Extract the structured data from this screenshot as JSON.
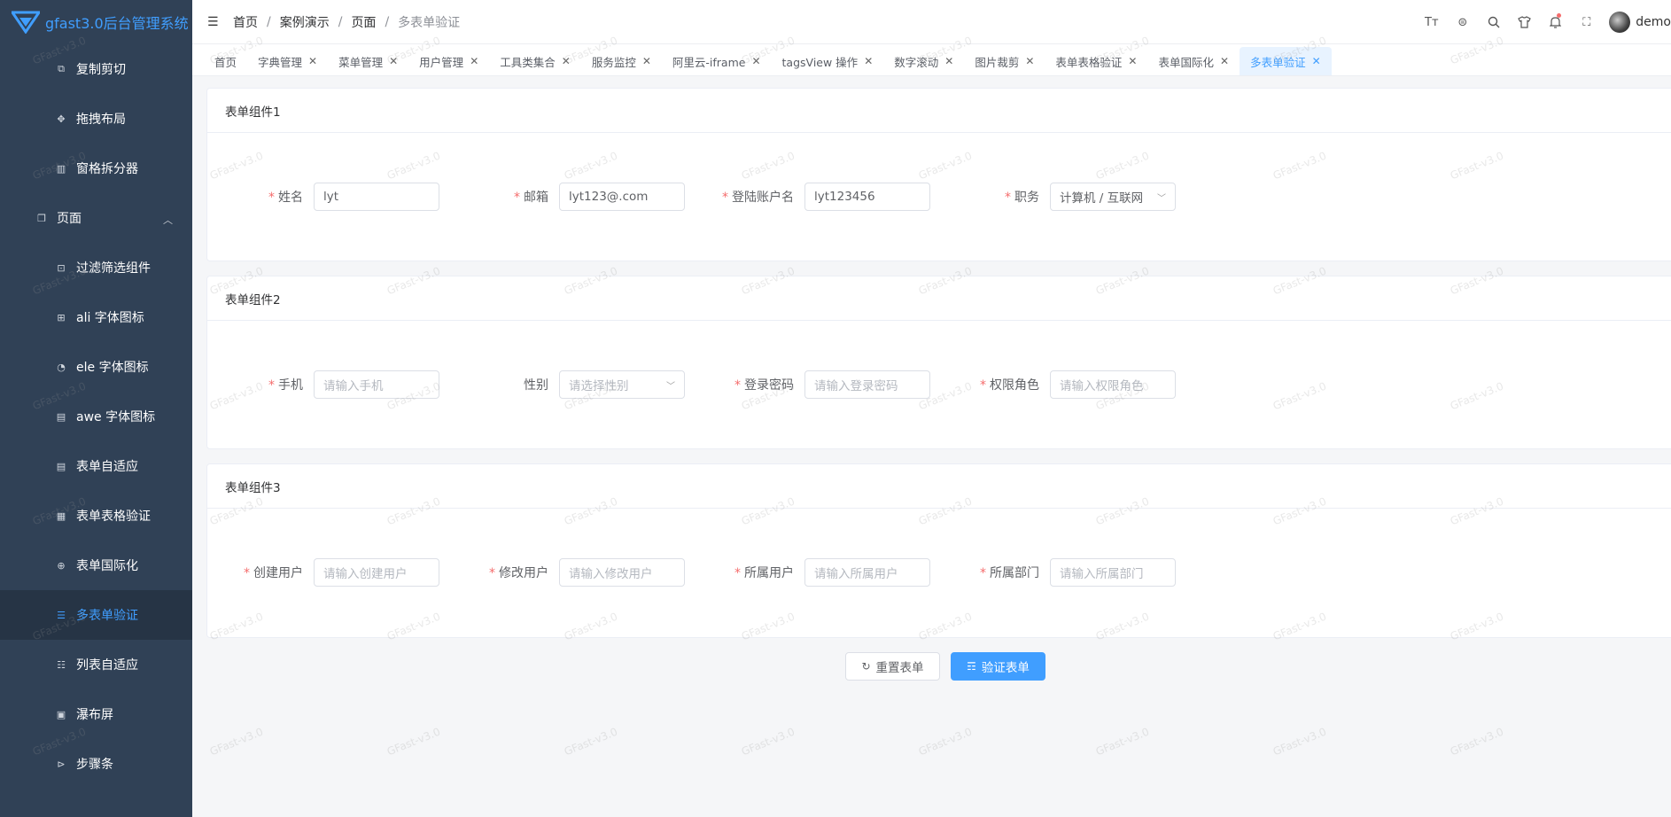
{
  "app": {
    "title": "gfast3.0后台管理系统",
    "watermark": "GFast-v3.0"
  },
  "sidebar": {
    "items": [
      {
        "label": "复制剪切",
        "icon": "copy-icon"
      },
      {
        "label": "拖拽布局",
        "icon": "drag-icon"
      },
      {
        "label": "窗格拆分器",
        "icon": "split-pane-icon"
      },
      {
        "label": "页面",
        "icon": "page-icon"
      },
      {
        "label": "过滤筛选组件",
        "icon": "filter-icon"
      },
      {
        "label": "ali 字体图标",
        "icon": "gift-icon"
      },
      {
        "label": "ele 字体图标",
        "icon": "ele-icon"
      },
      {
        "label": "awe 字体图标",
        "icon": "awe-icon"
      },
      {
        "label": "表单自适应",
        "icon": "form-icon"
      },
      {
        "label": "表单表格验证",
        "icon": "table-icon"
      },
      {
        "label": "表单国际化",
        "icon": "globe-icon"
      },
      {
        "label": "多表单验证",
        "icon": "forms-icon"
      },
      {
        "label": "列表自适应",
        "icon": "list-icon"
      },
      {
        "label": "瀑布屏",
        "icon": "waterfall-icon"
      },
      {
        "label": "步骤条",
        "icon": "steps-icon"
      }
    ]
  },
  "breadcrumb": [
    "首页",
    "案例演示",
    "页面",
    "多表单验证"
  ],
  "header": {
    "username": "demo"
  },
  "tabs": [
    {
      "label": "首页"
    },
    {
      "label": "字典管理"
    },
    {
      "label": "菜单管理"
    },
    {
      "label": "用户管理"
    },
    {
      "label": "工具类集合"
    },
    {
      "label": "服务监控"
    },
    {
      "label": "阿里云-iframe"
    },
    {
      "label": "tagsView 操作"
    },
    {
      "label": "数字滚动"
    },
    {
      "label": "图片裁剪"
    },
    {
      "label": "表单表格验证"
    },
    {
      "label": "表单国际化"
    },
    {
      "label": "多表单验证"
    }
  ],
  "forms": [
    {
      "title": "表单组件1",
      "fields": [
        {
          "label": "姓名",
          "value": "lyt",
          "placeholder": "",
          "required": "*"
        },
        {
          "label": "邮箱",
          "value": "lyt123@.com",
          "placeholder": "",
          "required": "*"
        },
        {
          "label": "登陆账户名",
          "value": "lyt123456",
          "placeholder": "",
          "required": "*"
        },
        {
          "label": "职务",
          "value": "计算机 / 互联网",
          "placeholder": "",
          "required": "*"
        }
      ]
    },
    {
      "title": "表单组件2",
      "fields": [
        {
          "label": "手机",
          "value": "",
          "placeholder": "请输入手机",
          "required": "*"
        },
        {
          "label": "性别",
          "value": "",
          "placeholder": "请选择性别",
          "required": ""
        },
        {
          "label": "登录密码",
          "value": "",
          "placeholder": "请输入登录密码",
          "required": "*"
        },
        {
          "label": "权限角色",
          "value": "",
          "placeholder": "请输入权限角色",
          "required": "*"
        }
      ]
    },
    {
      "title": "表单组件3",
      "fields": [
        {
          "label": "创建用户",
          "value": "",
          "placeholder": "请输入创建用户",
          "required": "*"
        },
        {
          "label": "修改用户",
          "value": "",
          "placeholder": "请输入修改用户",
          "required": "*"
        },
        {
          "label": "所属用户",
          "value": "",
          "placeholder": "请输入所属用户",
          "required": "*"
        },
        {
          "label": "所属部门",
          "value": "",
          "placeholder": "请输入所属部门",
          "required": "*"
        }
      ]
    }
  ],
  "actions": {
    "reset_label": "重置表单",
    "submit_label": "验证表单"
  },
  "colors": {
    "primary": "#409eff",
    "sidebar_bg": "#304156",
    "danger": "#f56c6c"
  }
}
